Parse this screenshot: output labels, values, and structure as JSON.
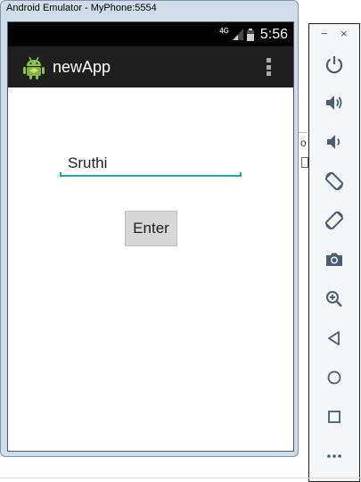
{
  "window": {
    "title": "Android Emulator - MyPhone:5554"
  },
  "status_bar": {
    "network": "4G",
    "time": "5:56"
  },
  "action_bar": {
    "app_title": "newApp",
    "app_icon": "android-robot-icon",
    "menu_icon": "overflow-menu-icon"
  },
  "form": {
    "name_value": "Sruthi",
    "enter_label": "Enter",
    "accent_color": "#2ba0c3"
  },
  "behind_window": {
    "partial_text": "o"
  },
  "control_panel": {
    "minimize_symbol": "−",
    "close_symbol": "×",
    "buttons": [
      "power-icon",
      "volume-up-icon",
      "volume-down-icon",
      "rotate-left-icon",
      "rotate-right-icon",
      "camera-icon",
      "zoom-icon",
      "back-icon",
      "home-icon",
      "overview-icon",
      "more-icon"
    ],
    "icon_color": "#4a5d72"
  }
}
